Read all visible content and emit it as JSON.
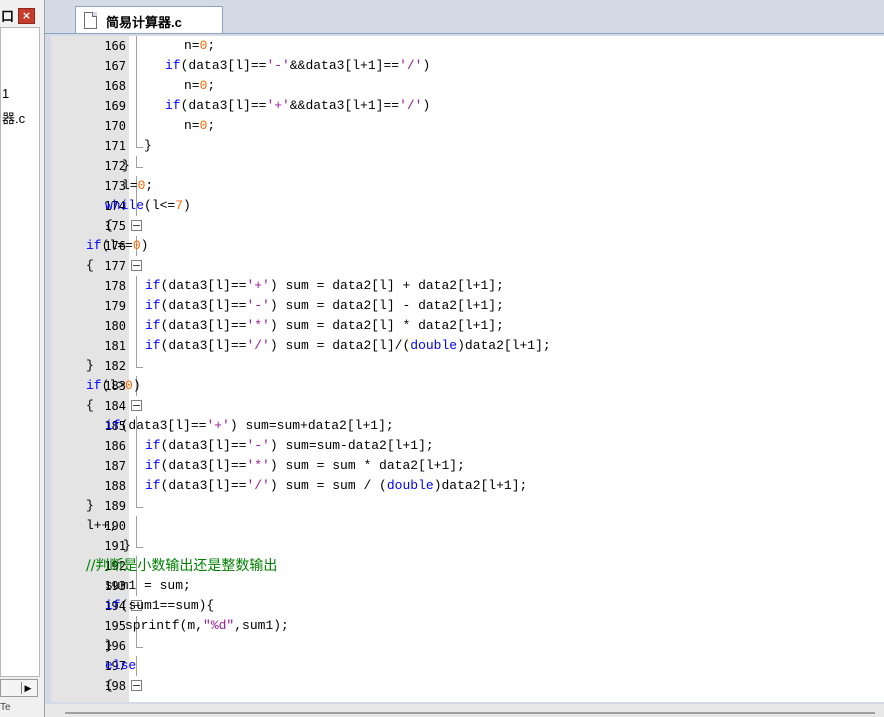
{
  "left_panel": {
    "title_fragment": "口",
    "close_glyph": "×",
    "items": [
      "1",
      "器.c"
    ],
    "status_fragment": "Te"
  },
  "tab": {
    "label": "简易计算器.c"
  },
  "lines": [
    {
      "n": "166",
      "tokens": [
        {
          "t": "n=",
          "c": ""
        },
        {
          "t": "0",
          "c": "num"
        },
        {
          "t": ";",
          "c": ""
        }
      ]
    },
    {
      "n": "167",
      "tokens": [
        {
          "t": "if",
          "c": "kw"
        },
        {
          "t": "(data3[l]==",
          "c": ""
        },
        {
          "t": "'-'",
          "c": "str"
        },
        {
          "t": "&&data3[l+1]==",
          "c": ""
        },
        {
          "t": "'/'",
          "c": "str"
        },
        {
          "t": ")",
          "c": ""
        }
      ]
    },
    {
      "n": "168",
      "tokens": [
        {
          "t": "n=",
          "c": ""
        },
        {
          "t": "0",
          "c": "num"
        },
        {
          "t": ";",
          "c": ""
        }
      ]
    },
    {
      "n": "169",
      "tokens": [
        {
          "t": "if",
          "c": "kw"
        },
        {
          "t": "(data3[l]==",
          "c": ""
        },
        {
          "t": "'+'",
          "c": "str"
        },
        {
          "t": "&&data3[l+1]==",
          "c": ""
        },
        {
          "t": "'/'",
          "c": "str"
        },
        {
          "t": ")",
          "c": ""
        }
      ]
    },
    {
      "n": "170",
      "tokens": [
        {
          "t": "n=",
          "c": ""
        },
        {
          "t": "0",
          "c": "num"
        },
        {
          "t": ";",
          "c": ""
        }
      ]
    },
    {
      "n": "171",
      "tokens": [
        {
          "t": "}",
          "c": ""
        }
      ]
    },
    {
      "n": "172",
      "tokens": [
        {
          "t": "}",
          "c": ""
        }
      ]
    },
    {
      "n": "173",
      "tokens": [
        {
          "t": "l=",
          "c": ""
        },
        {
          "t": "0",
          "c": "num"
        },
        {
          "t": ";",
          "c": ""
        }
      ]
    },
    {
      "n": "174",
      "tokens": [
        {
          "t": "while",
          "c": "kw"
        },
        {
          "t": "(l<=",
          "c": ""
        },
        {
          "t": "7",
          "c": "num"
        },
        {
          "t": ")",
          "c": ""
        }
      ]
    },
    {
      "n": "175",
      "tokens": [
        {
          "t": "{",
          "c": ""
        }
      ]
    },
    {
      "n": "176",
      "tokens": [
        {
          "t": "if",
          "c": "kw"
        },
        {
          "t": "(l==",
          "c": ""
        },
        {
          "t": "0",
          "c": "num"
        },
        {
          "t": ")",
          "c": ""
        }
      ]
    },
    {
      "n": "177",
      "tokens": [
        {
          "t": "{",
          "c": ""
        }
      ]
    },
    {
      "n": "178",
      "tokens": [
        {
          "t": "if",
          "c": "kw"
        },
        {
          "t": "(data3[l]==",
          "c": ""
        },
        {
          "t": "'+'",
          "c": "str"
        },
        {
          "t": ") sum = data2[l] + data2[l+1];",
          "c": ""
        }
      ]
    },
    {
      "n": "179",
      "tokens": [
        {
          "t": "if",
          "c": "kw"
        },
        {
          "t": "(data3[l]==",
          "c": ""
        },
        {
          "t": "'-'",
          "c": "str"
        },
        {
          "t": ") sum = data2[l] - data2[l+1];",
          "c": ""
        }
      ]
    },
    {
      "n": "180",
      "tokens": [
        {
          "t": "if",
          "c": "kw"
        },
        {
          "t": "(data3[l]==",
          "c": ""
        },
        {
          "t": "'*'",
          "c": "str"
        },
        {
          "t": ") sum = data2[l] * data2[l+1];",
          "c": ""
        }
      ]
    },
    {
      "n": "181",
      "tokens": [
        {
          "t": "if",
          "c": "kw"
        },
        {
          "t": "(data3[l]==",
          "c": ""
        },
        {
          "t": "'/'",
          "c": "str"
        },
        {
          "t": ") sum = data2[l]/(",
          "c": ""
        },
        {
          "t": "double",
          "c": "kw"
        },
        {
          "t": ")data2[l+1];",
          "c": ""
        }
      ]
    },
    {
      "n": "182",
      "tokens": [
        {
          "t": "}",
          "c": ""
        }
      ]
    },
    {
      "n": "183",
      "tokens": [
        {
          "t": "if",
          "c": "kw"
        },
        {
          "t": "(l>",
          "c": ""
        },
        {
          "t": "0",
          "c": "num"
        },
        {
          "t": ")",
          "c": ""
        }
      ]
    },
    {
      "n": "184",
      "tokens": [
        {
          "t": "{",
          "c": ""
        }
      ]
    },
    {
      "n": "185",
      "tokens": [
        {
          "t": "if",
          "c": "kw"
        },
        {
          "t": "(data3[l]==",
          "c": ""
        },
        {
          "t": "'+'",
          "c": "str"
        },
        {
          "t": ") sum=sum+data2[l+1];",
          "c": ""
        }
      ]
    },
    {
      "n": "186",
      "tokens": [
        {
          "t": "if",
          "c": "kw"
        },
        {
          "t": "(data3[l]==",
          "c": ""
        },
        {
          "t": "'-'",
          "c": "str"
        },
        {
          "t": ") sum=sum-data2[l+1];",
          "c": ""
        }
      ]
    },
    {
      "n": "187",
      "tokens": [
        {
          "t": "if",
          "c": "kw"
        },
        {
          "t": "(data3[l]==",
          "c": ""
        },
        {
          "t": "'*'",
          "c": "str"
        },
        {
          "t": ") sum = sum * data2[l+1];",
          "c": ""
        }
      ]
    },
    {
      "n": "188",
      "tokens": [
        {
          "t": "if",
          "c": "kw"
        },
        {
          "t": "(data3[l]==",
          "c": ""
        },
        {
          "t": "'/'",
          "c": "str"
        },
        {
          "t": ") sum = sum / (",
          "c": ""
        },
        {
          "t": "double",
          "c": "kw"
        },
        {
          "t": ")data2[l+1];",
          "c": ""
        }
      ]
    },
    {
      "n": "189",
      "tokens": [
        {
          "t": "}",
          "c": ""
        }
      ]
    },
    {
      "n": "190",
      "tokens": [
        {
          "t": "l++;",
          "c": ""
        }
      ]
    },
    {
      "n": "191",
      "tokens": [
        {
          "t": "}",
          "c": ""
        }
      ]
    },
    {
      "n": "192",
      "tokens": [
        {
          "t": "//判断是小数输出还是整数输出",
          "c": "cm"
        }
      ]
    },
    {
      "n": "193",
      "tokens": [
        {
          "t": "sum1 = sum;",
          "c": ""
        }
      ]
    },
    {
      "n": "194",
      "tokens": [
        {
          "t": "if",
          "c": "kw"
        },
        {
          "t": "(sum1==sum){",
          "c": ""
        }
      ]
    },
    {
      "n": "195",
      "tokens": [
        {
          "t": "sprintf(m,",
          "c": ""
        },
        {
          "t": "\"%d\"",
          "c": "str"
        },
        {
          "t": ",sum1);",
          "c": ""
        }
      ]
    },
    {
      "n": "196",
      "tokens": [
        {
          "t": "}",
          "c": ""
        }
      ]
    },
    {
      "n": "197",
      "tokens": [
        {
          "t": "else",
          "c": "kw"
        }
      ]
    },
    {
      "n": "198",
      "tokens": [
        {
          "t": "{",
          "c": ""
        }
      ]
    }
  ]
}
